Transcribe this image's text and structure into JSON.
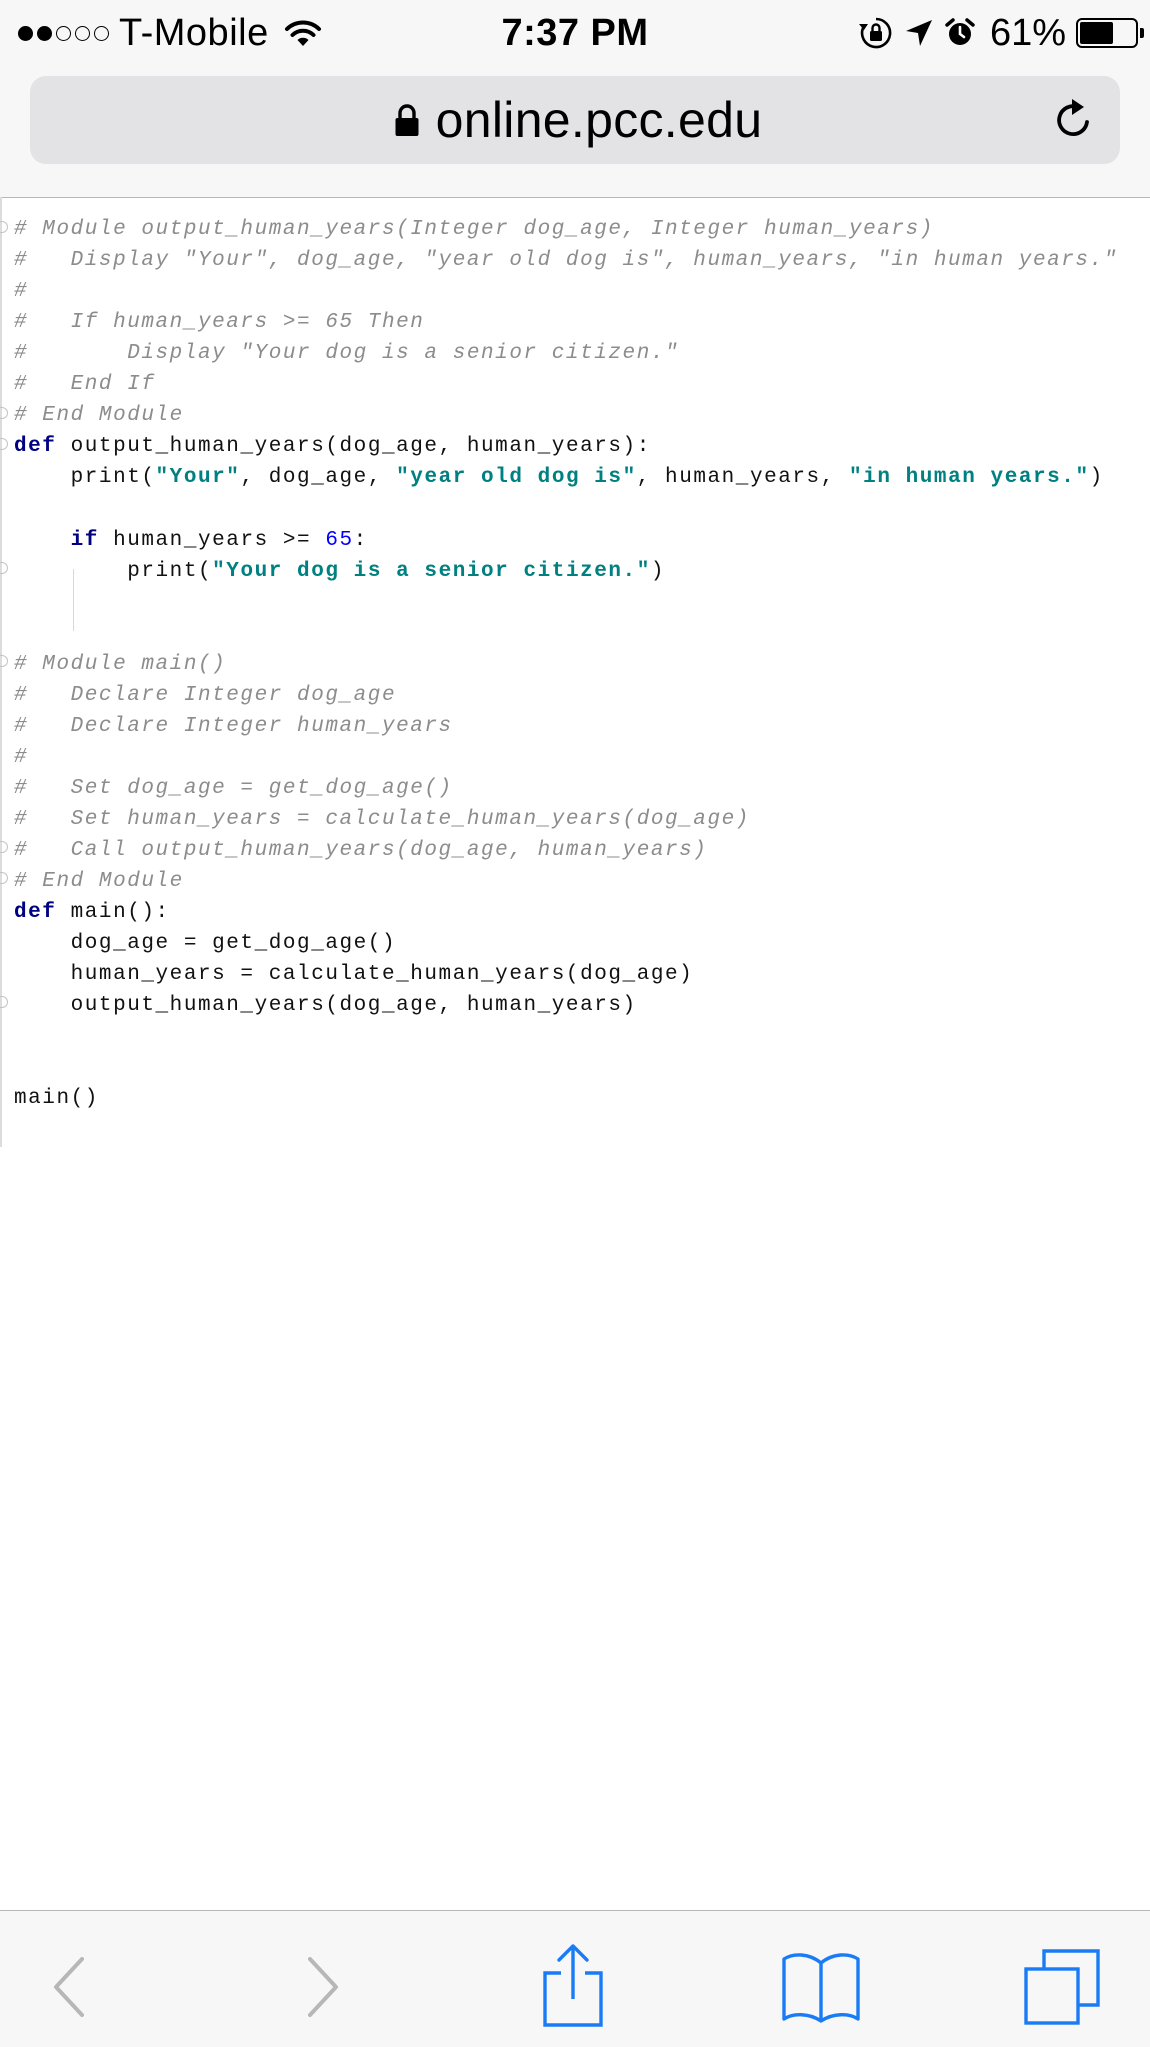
{
  "status_bar": {
    "carrier": "T-Mobile",
    "signal_strength": 2,
    "signal_max": 5,
    "time": "7:37 PM",
    "battery_percent": "61%",
    "battery_level": 0.61,
    "icons": [
      "wifi-icon",
      "orientation-lock-icon",
      "location-arrow-icon",
      "alarm-icon",
      "battery-icon"
    ]
  },
  "browser": {
    "url": "online.pcc.edu",
    "secure_icon": "lock-icon",
    "reload_icon": "reload-icon"
  },
  "code": {
    "lines": [
      [
        {
          "t": "# Module output_human_years(Integer dog_age, Integer human_years)",
          "c": "comment"
        }
      ],
      [
        {
          "t": "#   Display \"Your\", dog_age, \"year old dog is\", human_years, \"in human years.\"",
          "c": "comment"
        }
      ],
      [
        {
          "t": "#",
          "c": "comment"
        }
      ],
      [
        {
          "t": "#   If human_years >= 65 Then",
          "c": "comment"
        }
      ],
      [
        {
          "t": "#       Display \"Your dog is a senior citizen.\"",
          "c": "comment"
        }
      ],
      [
        {
          "t": "#   End If",
          "c": "comment"
        }
      ],
      [
        {
          "t": "# End Module",
          "c": "comment"
        }
      ],
      [
        {
          "t": "def",
          "c": "keyword"
        },
        {
          "t": " output_human_years(dog_age, human_years):",
          "c": "plain"
        }
      ],
      [
        {
          "t": "    print(",
          "c": "plain"
        },
        {
          "t": "\"Your\"",
          "c": "string"
        },
        {
          "t": ", dog_age, ",
          "c": "plain"
        },
        {
          "t": "\"year old dog is\"",
          "c": "string"
        },
        {
          "t": ", human_years, ",
          "c": "plain"
        },
        {
          "t": "\"in human years.\"",
          "c": "string"
        },
        {
          "t": ")",
          "c": "plain"
        }
      ],
      [],
      [
        {
          "t": "    ",
          "c": "plain"
        },
        {
          "t": "if",
          "c": "keyword"
        },
        {
          "t": " human_years >= ",
          "c": "plain"
        },
        {
          "t": "65",
          "c": "number"
        },
        {
          "t": ":",
          "c": "plain"
        }
      ],
      [
        {
          "t": "        print(",
          "c": "plain"
        },
        {
          "t": "\"Your dog is a senior citizen.\"",
          "c": "string"
        },
        {
          "t": ")",
          "c": "plain"
        }
      ],
      [],
      [],
      [
        {
          "t": "# Module main()",
          "c": "comment"
        }
      ],
      [
        {
          "t": "#   Declare Integer dog_age",
          "c": "comment"
        }
      ],
      [
        {
          "t": "#   Declare Integer human_years",
          "c": "comment"
        }
      ],
      [
        {
          "t": "#",
          "c": "comment"
        }
      ],
      [
        {
          "t": "#   Set dog_age = get_dog_age()",
          "c": "comment"
        }
      ],
      [
        {
          "t": "#   Set human_years = calculate_human_years(dog_age)",
          "c": "comment"
        }
      ],
      [
        {
          "t": "#   Call output_human_years(dog_age, human_years)",
          "c": "comment"
        }
      ],
      [
        {
          "t": "# End Module",
          "c": "comment"
        }
      ],
      [
        {
          "t": "def",
          "c": "keyword"
        },
        {
          "t": " main():",
          "c": "plain"
        }
      ],
      [
        {
          "t": "    dog_age = get_dog_age()",
          "c": "plain"
        }
      ],
      [
        {
          "t": "    human_years = calculate_human_years(dog_age)",
          "c": "plain"
        }
      ],
      [
        {
          "t": "    output_human_years(dog_age, human_years)",
          "c": "plain"
        }
      ],
      [],
      [],
      [
        {
          "t": "main()",
          "c": "plain"
        }
      ]
    ]
  },
  "toolbar": {
    "buttons": [
      {
        "name": "back-button",
        "icon": "chevron-left-icon",
        "enabled": false
      },
      {
        "name": "forward-button",
        "icon": "chevron-right-icon",
        "enabled": false
      },
      {
        "name": "share-button",
        "icon": "share-icon",
        "enabled": true
      },
      {
        "name": "bookmarks-button",
        "icon": "book-icon",
        "enabled": true
      },
      {
        "name": "tabs-button",
        "icon": "tabs-icon",
        "enabled": true
      }
    ]
  },
  "colors": {
    "ios_blue": "#1a7cf5",
    "disabled_gray": "#b7b7b7",
    "comment": "#8c8c8c",
    "keyword": "#000080",
    "string": "#008080",
    "number": "#0000ff"
  }
}
